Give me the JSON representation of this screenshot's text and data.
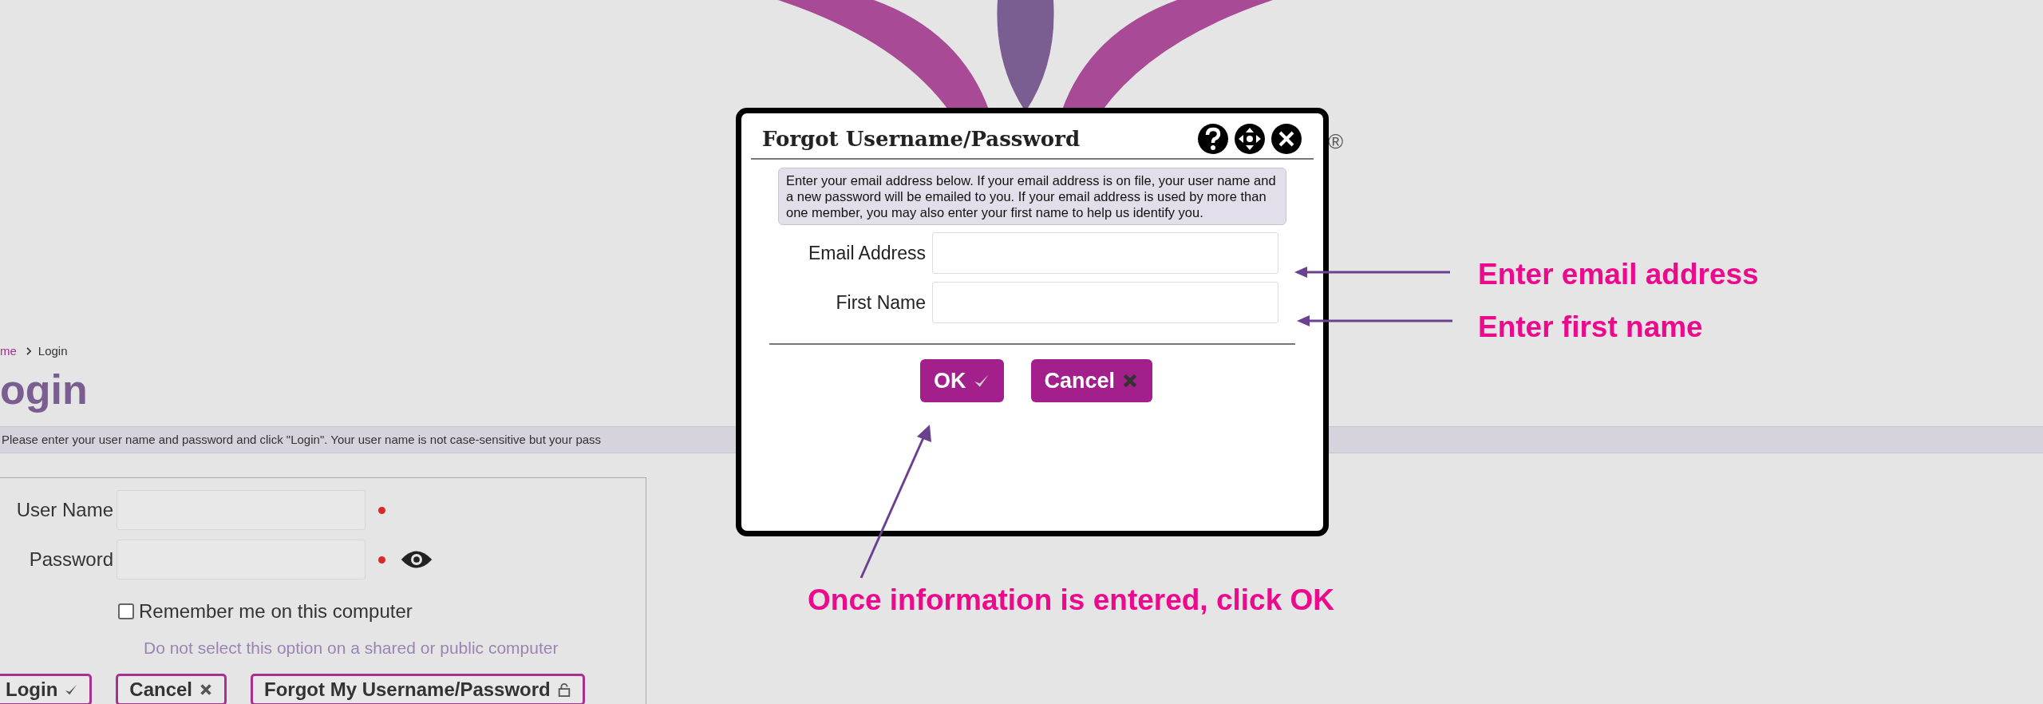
{
  "page": {
    "logo_mark": "®",
    "breadcrumb": [
      {
        "label": "me",
        "current": false
      },
      {
        "label": "Login",
        "current": true
      }
    ],
    "title": "ogin",
    "notice": "Please enter your user name and password and click \"Login\". Your user name is not case-sensitive but your pass",
    "form": {
      "fields": [
        {
          "label": "User Name",
          "required": true,
          "kind": "text"
        },
        {
          "label": "Password",
          "required": true,
          "kind": "password"
        }
      ],
      "remember": {
        "label": "Remember me on this computer",
        "checked": false
      },
      "hint": "Do not select this option on a shared or public computer",
      "buttons": [
        {
          "label": "Login"
        },
        {
          "label": "Cancel"
        },
        {
          "label": "Forgot My Username/Password"
        }
      ]
    }
  },
  "dialog": {
    "title": "Forgot Username/Password",
    "message": "Enter your email address below. If your email address is on file, your user name and a new password will be emailed to you. If your email address is used by more than one member, you may also enter your first name to help us identify you.",
    "fields": [
      {
        "label": "Email Address"
      },
      {
        "label": "First Name"
      }
    ],
    "buttons": [
      {
        "label": "OK"
      },
      {
        "label": "Cancel"
      }
    ]
  },
  "annotations": [
    {
      "text": "Enter email address"
    },
    {
      "text": "Enter first name"
    },
    {
      "text": "Once information is entered, click OK"
    }
  ]
}
